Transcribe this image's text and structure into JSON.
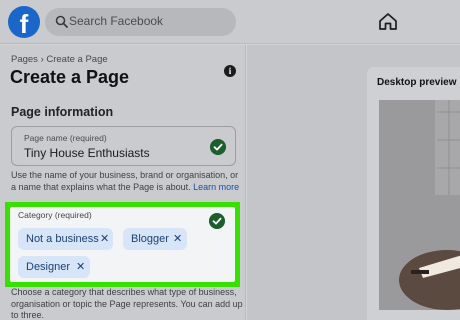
{
  "header": {
    "logo_letter": "f",
    "search_placeholder": "Search Facebook"
  },
  "sidebar": {
    "breadcrumb": "Pages › Create a Page",
    "title": "Create a Page",
    "section_title": "Page information",
    "page_name": {
      "label": "Page name (required)",
      "value": "Tiny House Enthusiasts"
    },
    "page_name_helper": "Use the name of your business, brand or organisation, or a name that explains what the Page is about.",
    "page_name_helper_link": "Learn more",
    "category": {
      "label": "Category (required)",
      "chips": [
        "Not a business",
        "Blogger",
        "Designer"
      ],
      "remove_glyph": "✕"
    },
    "category_helper": "Choose a category that describes what type of business, organisation or topic the Page represents. You can add up to three."
  },
  "preview": {
    "title": "Desktop preview"
  },
  "colors": {
    "facebook_blue": "#1b66c9",
    "highlight_green": "#38e000",
    "check_green": "#1c5f2c",
    "chip_bg": "#d6e5f8"
  }
}
